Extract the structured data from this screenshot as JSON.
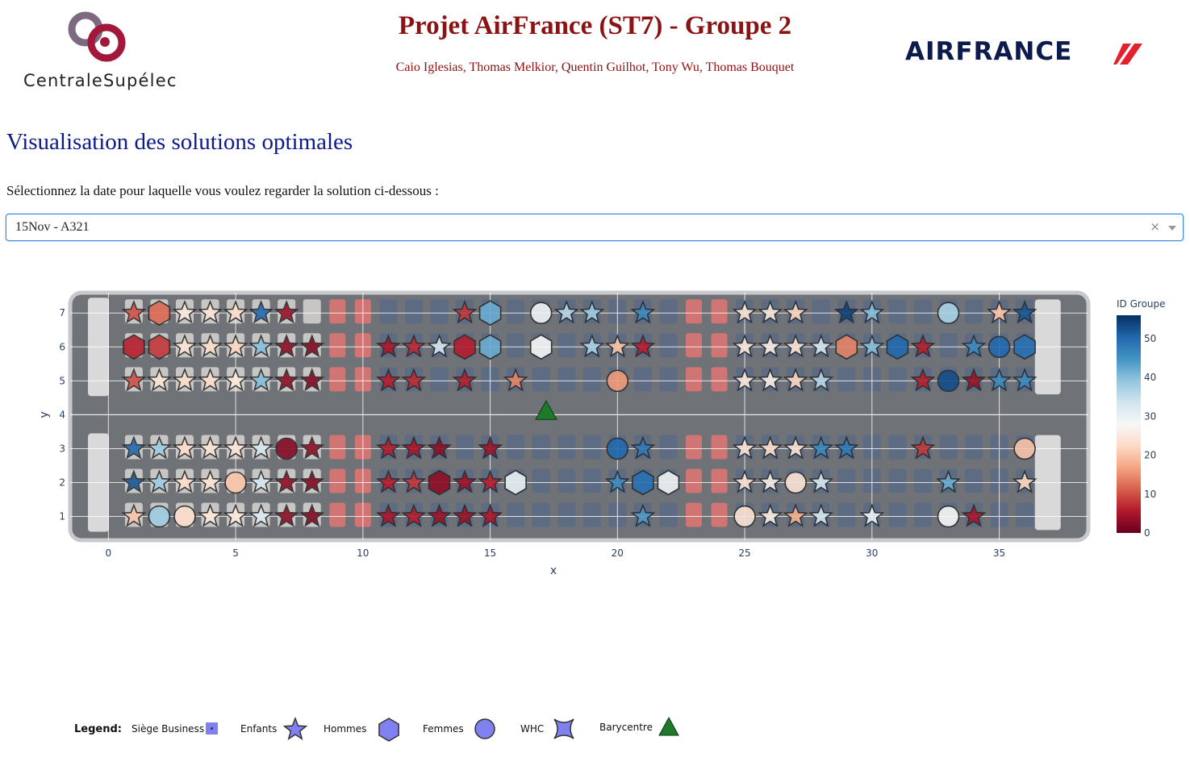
{
  "header": {
    "university_logo_text": "CentraleSupélec",
    "title": "Projet AirFrance (ST7) - Groupe 2",
    "authors": "Caio Iglesias, Thomas Melkior, Quentin Guilhot, Tony Wu, Thomas Bouquet",
    "airline_logo_text": "AIRFRANCE"
  },
  "section_title": "Visualisation des solutions optimales",
  "date_prompt": "Sélectionnez la date pour laquelle vous voulez regarder la solution ci-dessous :",
  "dropdown": {
    "selected": "15Nov - A321",
    "clear_icon": "×"
  },
  "colors": {
    "title": "#8b1313",
    "section": "#0d1a8a",
    "barycentre": "#1e7a2a"
  },
  "chart_data": {
    "type": "scatter",
    "xlabel": "x",
    "ylabel": "y",
    "xlim": [
      -1.5,
      38.5
    ],
    "ylim": [
      0.3,
      7.6
    ],
    "xticks": [
      0,
      5,
      10,
      15,
      20,
      25,
      30,
      35
    ],
    "yticks": [
      1,
      2,
      3,
      4,
      5,
      6,
      7
    ],
    "colorbar": {
      "title": "ID Groupe",
      "ticks": [
        0,
        10,
        20,
        30,
        40,
        50
      ],
      "range": [
        0,
        56
      ],
      "colorscale": "RdBu"
    },
    "barycentre": {
      "x": 17.2,
      "y": 4.1
    },
    "points": [
      {
        "x": 1,
        "y": 7,
        "g": 10,
        "s": "star"
      },
      {
        "x": 2,
        "y": 7,
        "g": 12,
        "s": "hexagon"
      },
      {
        "x": 3,
        "y": 7,
        "g": 25,
        "s": "star"
      },
      {
        "x": 4,
        "y": 7,
        "g": 24,
        "s": "star"
      },
      {
        "x": 5,
        "y": 7,
        "g": 23,
        "s": "star"
      },
      {
        "x": 6,
        "y": 7,
        "g": 50,
        "s": "star"
      },
      {
        "x": 7,
        "y": 7,
        "g": 4,
        "s": "star"
      },
      {
        "x": 14,
        "y": 7,
        "g": 8,
        "s": "star"
      },
      {
        "x": 15,
        "y": 7,
        "g": 42,
        "s": "hexagon"
      },
      {
        "x": 17,
        "y": 7,
        "g": 29,
        "s": "circle"
      },
      {
        "x": 18,
        "y": 7,
        "g": 36,
        "s": "star"
      },
      {
        "x": 19,
        "y": 7,
        "g": 38,
        "s": "star"
      },
      {
        "x": 21,
        "y": 7,
        "g": 46,
        "s": "star"
      },
      {
        "x": 25,
        "y": 7,
        "g": 24,
        "s": "star"
      },
      {
        "x": 26,
        "y": 7,
        "g": 25,
        "s": "star"
      },
      {
        "x": 27,
        "y": 7,
        "g": 22,
        "s": "star"
      },
      {
        "x": 29,
        "y": 7,
        "g": 54,
        "s": "star"
      },
      {
        "x": 30,
        "y": 7,
        "g": 40,
        "s": "star"
      },
      {
        "x": 33,
        "y": 7,
        "g": 37,
        "s": "circle"
      },
      {
        "x": 35,
        "y": 7,
        "g": 20,
        "s": "star"
      },
      {
        "x": 36,
        "y": 7,
        "g": 52,
        "s": "star"
      },
      {
        "x": 1,
        "y": 6,
        "g": 6,
        "s": "hexagon"
      },
      {
        "x": 2,
        "y": 6,
        "g": 8,
        "s": "hexagon"
      },
      {
        "x": 3,
        "y": 6,
        "g": 24,
        "s": "star"
      },
      {
        "x": 4,
        "y": 6,
        "g": 23,
        "s": "star"
      },
      {
        "x": 5,
        "y": 6,
        "g": 22,
        "s": "star"
      },
      {
        "x": 6,
        "y": 6,
        "g": 40,
        "s": "star"
      },
      {
        "x": 7,
        "y": 6,
        "g": 3,
        "s": "star"
      },
      {
        "x": 8,
        "y": 6,
        "g": 2,
        "s": "star"
      },
      {
        "x": 11,
        "y": 6,
        "g": 5,
        "s": "star"
      },
      {
        "x": 12,
        "y": 6,
        "g": 7,
        "s": "star"
      },
      {
        "x": 13,
        "y": 6,
        "g": 33,
        "s": "star"
      },
      {
        "x": 14,
        "y": 6,
        "g": 6,
        "s": "hexagon"
      },
      {
        "x": 15,
        "y": 6,
        "g": 42,
        "s": "hexagon"
      },
      {
        "x": 17,
        "y": 6,
        "g": 28,
        "s": "hexagon"
      },
      {
        "x": 19,
        "y": 6,
        "g": 37,
        "s": "star"
      },
      {
        "x": 20,
        "y": 6,
        "g": 20,
        "s": "star"
      },
      {
        "x": 21,
        "y": 6,
        "g": 6,
        "s": "star"
      },
      {
        "x": 25,
        "y": 6,
        "g": 25,
        "s": "star"
      },
      {
        "x": 26,
        "y": 6,
        "g": 26,
        "s": "star"
      },
      {
        "x": 27,
        "y": 6,
        "g": 24,
        "s": "star"
      },
      {
        "x": 28,
        "y": 6,
        "g": 33,
        "s": "star"
      },
      {
        "x": 29,
        "y": 6,
        "g": 14,
        "s": "hexagon"
      },
      {
        "x": 30,
        "y": 6,
        "g": 40,
        "s": "star"
      },
      {
        "x": 31,
        "y": 6,
        "g": 50,
        "s": "hexagon"
      },
      {
        "x": 32,
        "y": 6,
        "g": 6,
        "s": "star"
      },
      {
        "x": 34,
        "y": 6,
        "g": 46,
        "s": "star"
      },
      {
        "x": 35,
        "y": 6,
        "g": 50,
        "s": "circle"
      },
      {
        "x": 36,
        "y": 6,
        "g": 49,
        "s": "hexagon"
      },
      {
        "x": 1,
        "y": 5,
        "g": 10,
        "s": "star"
      },
      {
        "x": 2,
        "y": 5,
        "g": 24,
        "s": "star"
      },
      {
        "x": 3,
        "y": 5,
        "g": 23,
        "s": "star"
      },
      {
        "x": 4,
        "y": 5,
        "g": 23,
        "s": "star"
      },
      {
        "x": 5,
        "y": 5,
        "g": 25,
        "s": "star"
      },
      {
        "x": 6,
        "y": 5,
        "g": 40,
        "s": "star"
      },
      {
        "x": 7,
        "y": 5,
        "g": 3,
        "s": "star"
      },
      {
        "x": 8,
        "y": 5,
        "g": 2,
        "s": "star"
      },
      {
        "x": 11,
        "y": 5,
        "g": 6,
        "s": "star"
      },
      {
        "x": 12,
        "y": 5,
        "g": 7,
        "s": "star"
      },
      {
        "x": 14,
        "y": 5,
        "g": 6,
        "s": "star"
      },
      {
        "x": 16,
        "y": 5,
        "g": 14,
        "s": "star"
      },
      {
        "x": 20,
        "y": 5,
        "g": 16,
        "s": "circle"
      },
      {
        "x": 25,
        "y": 5,
        "g": 25,
        "s": "star"
      },
      {
        "x": 26,
        "y": 5,
        "g": 26,
        "s": "star"
      },
      {
        "x": 27,
        "y": 5,
        "g": 22,
        "s": "star"
      },
      {
        "x": 28,
        "y": 5,
        "g": 36,
        "s": "star"
      },
      {
        "x": 32,
        "y": 5,
        "g": 6,
        "s": "star"
      },
      {
        "x": 33,
        "y": 5,
        "g": 53,
        "s": "circle"
      },
      {
        "x": 34,
        "y": 5,
        "g": 4,
        "s": "star"
      },
      {
        "x": 35,
        "y": 5,
        "g": 46,
        "s": "star"
      },
      {
        "x": 36,
        "y": 5,
        "g": 46,
        "s": "star"
      },
      {
        "x": 1,
        "y": 3,
        "g": 50,
        "s": "star"
      },
      {
        "x": 2,
        "y": 3,
        "g": 38,
        "s": "star"
      },
      {
        "x": 3,
        "y": 3,
        "g": 23,
        "s": "star"
      },
      {
        "x": 4,
        "y": 3,
        "g": 24,
        "s": "star"
      },
      {
        "x": 5,
        "y": 3,
        "g": 24,
        "s": "star"
      },
      {
        "x": 6,
        "y": 3,
        "g": 33,
        "s": "star"
      },
      {
        "x": 7,
        "y": 3,
        "g": 2,
        "s": "circle"
      },
      {
        "x": 8,
        "y": 3,
        "g": 3,
        "s": "star"
      },
      {
        "x": 11,
        "y": 3,
        "g": 6,
        "s": "star"
      },
      {
        "x": 12,
        "y": 3,
        "g": 5,
        "s": "star"
      },
      {
        "x": 13,
        "y": 3,
        "g": 3,
        "s": "star"
      },
      {
        "x": 15,
        "y": 3,
        "g": 4,
        "s": "star"
      },
      {
        "x": 20,
        "y": 3,
        "g": 50,
        "s": "circle"
      },
      {
        "x": 21,
        "y": 3,
        "g": 48,
        "s": "star"
      },
      {
        "x": 25,
        "y": 3,
        "g": 24,
        "s": "star"
      },
      {
        "x": 26,
        "y": 3,
        "g": 23,
        "s": "star"
      },
      {
        "x": 27,
        "y": 3,
        "g": 24,
        "s": "star"
      },
      {
        "x": 28,
        "y": 3,
        "g": 46,
        "s": "star"
      },
      {
        "x": 29,
        "y": 3,
        "g": 48,
        "s": "star"
      },
      {
        "x": 32,
        "y": 3,
        "g": 8,
        "s": "star"
      },
      {
        "x": 36,
        "y": 3,
        "g": 20,
        "s": "circle"
      },
      {
        "x": 1,
        "y": 2,
        "g": 52,
        "s": "star"
      },
      {
        "x": 2,
        "y": 2,
        "g": 38,
        "s": "star"
      },
      {
        "x": 3,
        "y": 2,
        "g": 23,
        "s": "star"
      },
      {
        "x": 4,
        "y": 2,
        "g": 24,
        "s": "star"
      },
      {
        "x": 5,
        "y": 2,
        "g": 20,
        "s": "circle"
      },
      {
        "x": 6,
        "y": 2,
        "g": 33,
        "s": "star"
      },
      {
        "x": 7,
        "y": 2,
        "g": 3,
        "s": "star"
      },
      {
        "x": 8,
        "y": 2,
        "g": 2,
        "s": "star"
      },
      {
        "x": 11,
        "y": 2,
        "g": 6,
        "s": "star"
      },
      {
        "x": 12,
        "y": 2,
        "g": 8,
        "s": "star"
      },
      {
        "x": 13,
        "y": 2,
        "g": 3,
        "s": "hexagon"
      },
      {
        "x": 14,
        "y": 2,
        "g": 4,
        "s": "star"
      },
      {
        "x": 15,
        "y": 2,
        "g": 6,
        "s": "star"
      },
      {
        "x": 16,
        "y": 2,
        "g": 30,
        "s": "hexagon"
      },
      {
        "x": 20,
        "y": 2,
        "g": 46,
        "s": "star"
      },
      {
        "x": 21,
        "y": 2,
        "g": 49,
        "s": "hexagon"
      },
      {
        "x": 22,
        "y": 2,
        "g": 29,
        "s": "hexagon"
      },
      {
        "x": 25,
        "y": 2,
        "g": 24,
        "s": "star"
      },
      {
        "x": 26,
        "y": 2,
        "g": 26,
        "s": "star"
      },
      {
        "x": 27,
        "y": 2,
        "g": 24,
        "s": "circle"
      },
      {
        "x": 28,
        "y": 2,
        "g": 33,
        "s": "star"
      },
      {
        "x": 33,
        "y": 2,
        "g": 42,
        "s": "star"
      },
      {
        "x": 36,
        "y": 2,
        "g": 22,
        "s": "star"
      },
      {
        "x": 1,
        "y": 1,
        "g": 20,
        "s": "star"
      },
      {
        "x": 2,
        "y": 1,
        "g": 38,
        "s": "circle"
      },
      {
        "x": 3,
        "y": 1,
        "g": 23,
        "s": "circle"
      },
      {
        "x": 4,
        "y": 1,
        "g": 25,
        "s": "star"
      },
      {
        "x": 5,
        "y": 1,
        "g": 25,
        "s": "star"
      },
      {
        "x": 6,
        "y": 1,
        "g": 32,
        "s": "star"
      },
      {
        "x": 7,
        "y": 1,
        "g": 3,
        "s": "star"
      },
      {
        "x": 8,
        "y": 1,
        "g": 2,
        "s": "star"
      },
      {
        "x": 11,
        "y": 1,
        "g": 5,
        "s": "star"
      },
      {
        "x": 12,
        "y": 1,
        "g": 6,
        "s": "star"
      },
      {
        "x": 13,
        "y": 1,
        "g": 4,
        "s": "star"
      },
      {
        "x": 14,
        "y": 1,
        "g": 4,
        "s": "star"
      },
      {
        "x": 15,
        "y": 1,
        "g": 5,
        "s": "star"
      },
      {
        "x": 21,
        "y": 1,
        "g": 44,
        "s": "star"
      },
      {
        "x": 25,
        "y": 1,
        "g": 24,
        "s": "circle"
      },
      {
        "x": 26,
        "y": 1,
        "g": 26,
        "s": "star"
      },
      {
        "x": 27,
        "y": 1,
        "g": 18,
        "s": "star"
      },
      {
        "x": 28,
        "y": 1,
        "g": 33,
        "s": "star"
      },
      {
        "x": 30,
        "y": 1,
        "g": 30,
        "s": "star"
      },
      {
        "x": 33,
        "y": 1,
        "g": 28,
        "s": "circle"
      },
      {
        "x": 34,
        "y": 1,
        "g": 5,
        "s": "star"
      }
    ]
  },
  "legend": {
    "heading": "Legend:",
    "items": [
      {
        "label": "Siège Business",
        "icon": "square-dot-icon"
      },
      {
        "label": "Enfants",
        "icon": "star-icon"
      },
      {
        "label": "Hommes",
        "icon": "hexagon-icon"
      },
      {
        "label": "Femmes",
        "icon": "circle-icon"
      },
      {
        "label": "WHC",
        "icon": "square-concave-icon"
      },
      {
        "label": "Barycentre",
        "icon": "triangle-icon"
      }
    ]
  }
}
